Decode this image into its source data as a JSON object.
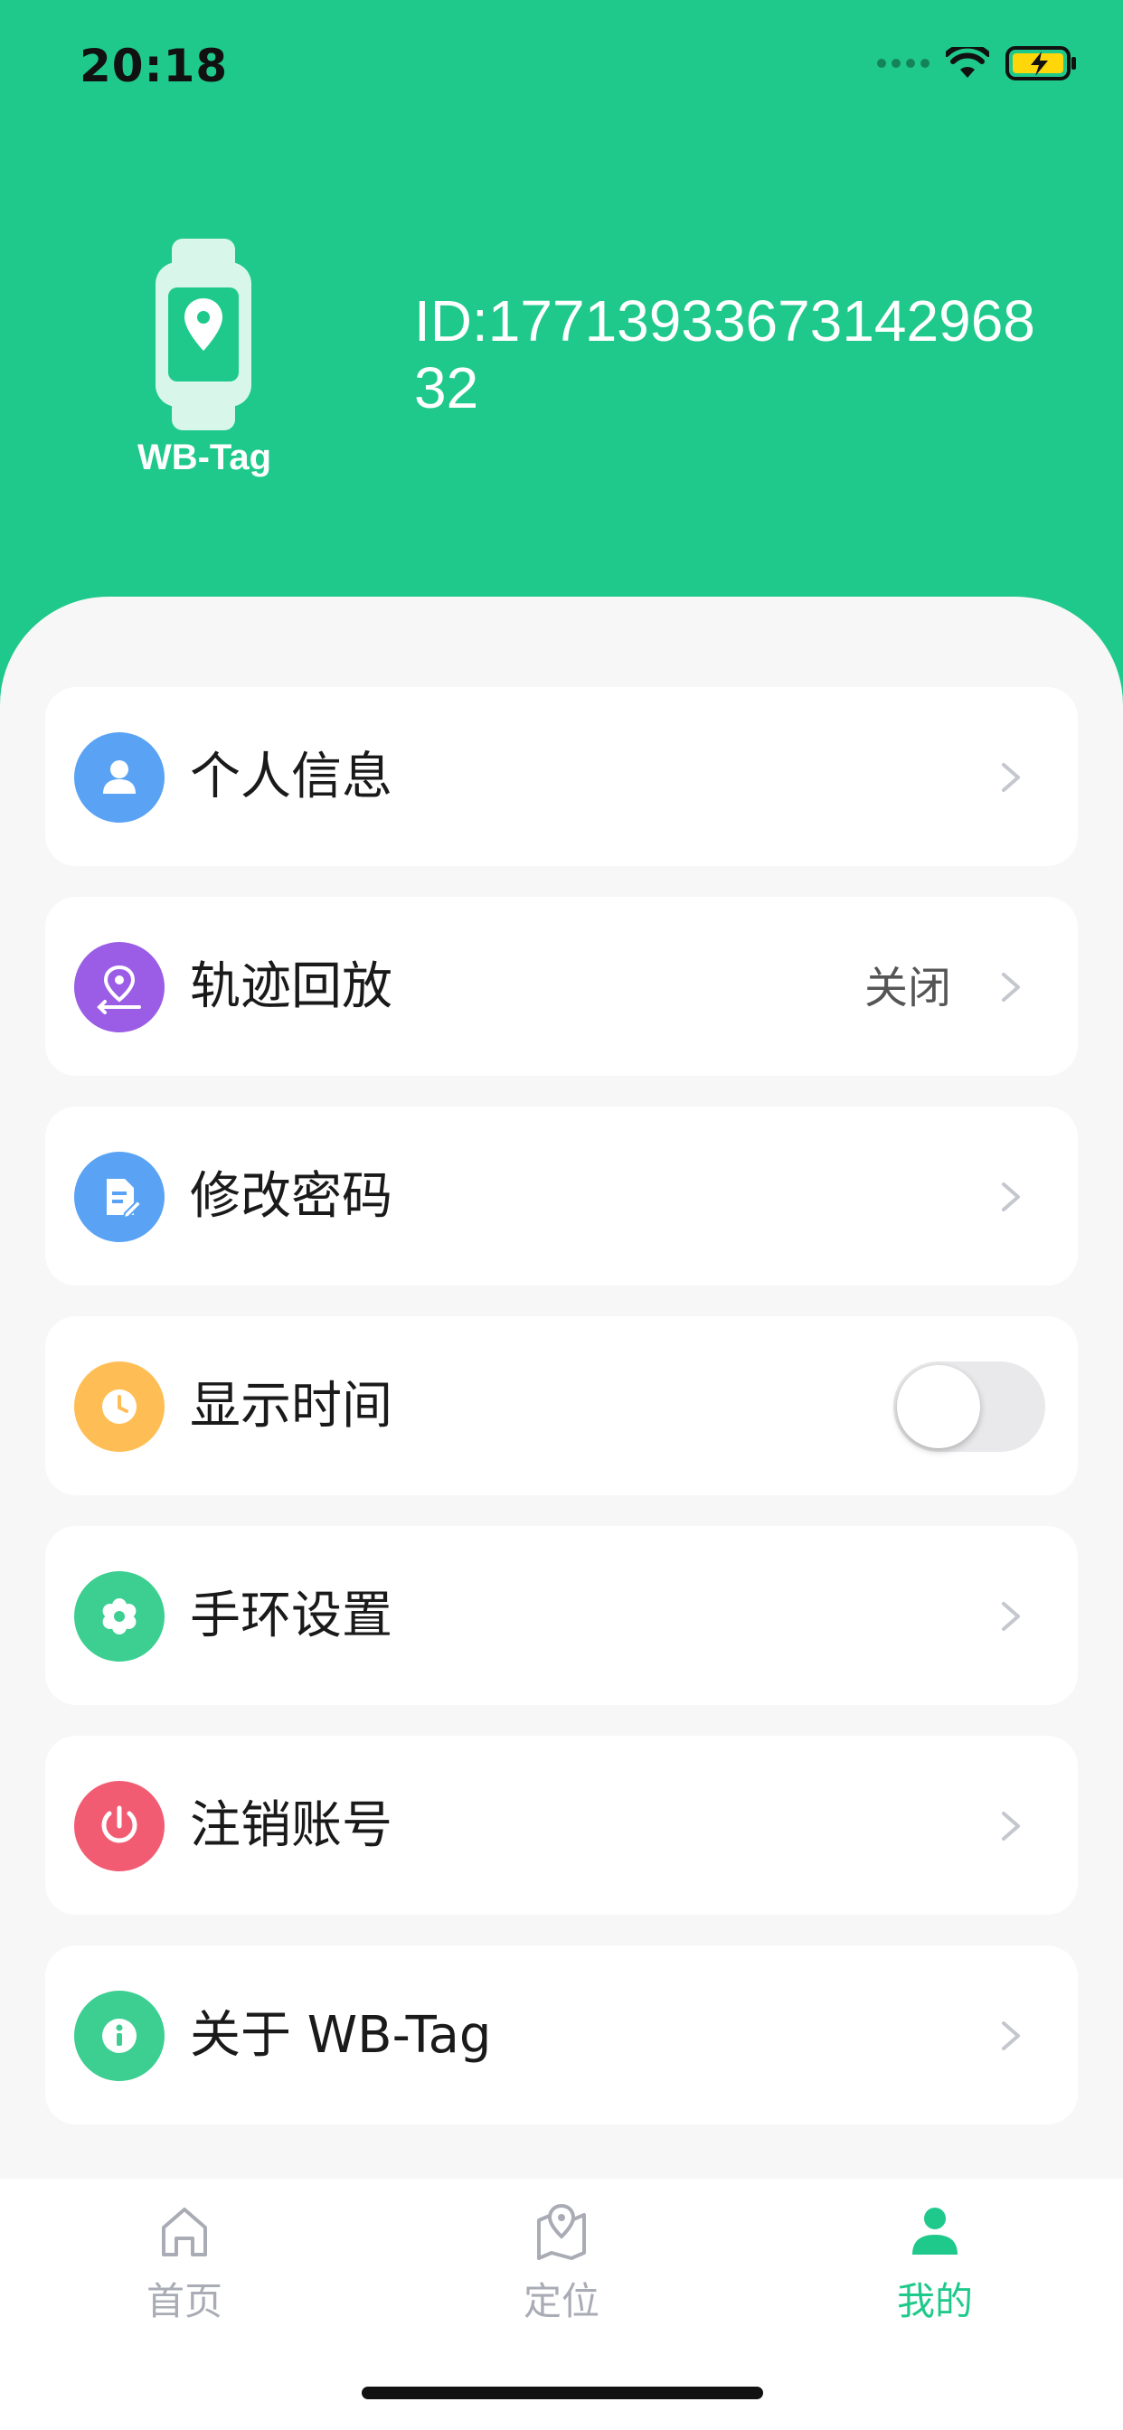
{
  "status": {
    "time": "20:18"
  },
  "profile": {
    "device_name": "WB-Tag",
    "device_id": "ID:1771393367314296832"
  },
  "menu": {
    "personal_info": "个人信息",
    "track_playback": "轨迹回放",
    "track_playback_value": "关闭",
    "change_password": "修改密码",
    "show_time": "显示时间",
    "band_settings": "手环设置",
    "deactivate_account": "注销账号",
    "about": "关于 WB-Tag"
  },
  "tabs": {
    "home": "首页",
    "location": "定位",
    "mine": "我的"
  },
  "colors": {
    "brand": "#1fc98b",
    "icon_personal": "#5aa3f4",
    "icon_track": "#9b5de5",
    "icon_password": "#5aa3f4",
    "icon_time": "#ffbe55",
    "icon_settings": "#3ccf91",
    "icon_deactivate": "#f25c73",
    "icon_about": "#3ccf91",
    "tab_inactive": "#a9acb5"
  },
  "toggles": {
    "show_time_on": false
  }
}
